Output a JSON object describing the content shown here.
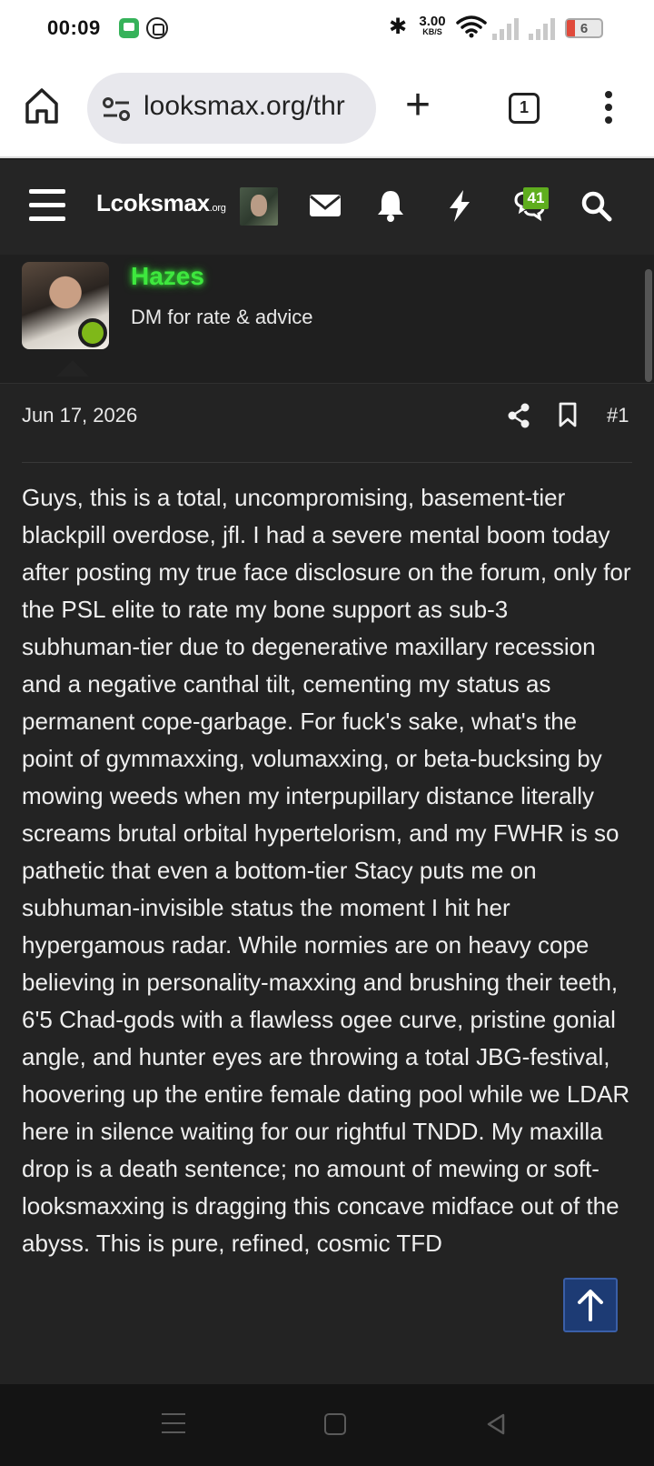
{
  "status_bar": {
    "time": "00:09",
    "net_speed_value": "3.00",
    "net_speed_unit": "KB/S",
    "battery": "6"
  },
  "browser": {
    "url": "looksmax.org/thr",
    "tab_count": "1"
  },
  "site_header": {
    "logo_text": "Lcoksmax",
    "logo_suffix": ".org",
    "conversations_badge": "41",
    "icons": [
      "menu-icon",
      "envelope-icon",
      "bell-icon",
      "bolt-icon",
      "chat-bubbles-icon",
      "search-icon"
    ]
  },
  "post": {
    "username": "Hazes",
    "user_title": "DM for rate & advice",
    "date": "Jun 17, 2026",
    "post_number": "#1",
    "body": "Guys, this is a total, uncompromising, basement-tier blackpill overdose, jfl. I had a severe mental boom today after posting my true face disclosure on the forum, only for the PSL elite to rate my bone support as sub-3 subhuman-tier due to degenerative maxillary recession and a negative canthal tilt, cementing my status as permanent cope-garbage. For fuck's sake, what's the point of gymmaxxing, volumaxxing, or beta-bucksing by mowing weeds when my interpupillary distance literally screams brutal orbital hypertelorism, and my FWHR is so pathetic that even a bottom-tier Stacy puts me on subhuman-invisible status the moment I hit her hypergamous radar. While normies are on heavy cope believing in personality-maxxing and brushing their teeth, 6'5 Chad-gods with a flawless ogee curve, pristine gonial angle, and hunter eyes are throwing a total JBG-festival, hoovering up the entire female dating pool while we LDAR here in silence waiting for our rightful TNDD. My maxilla drop is a death sentence; no amount of mewing or soft-looksmaxxing is dragging this concave midface out of the abyss. This is pure, refined, cosmic TFD"
  },
  "colors": {
    "username": "#3ee83e",
    "online": "#7fb819",
    "badge": "#5fad1e",
    "scroll_top": "#1d3b74"
  }
}
